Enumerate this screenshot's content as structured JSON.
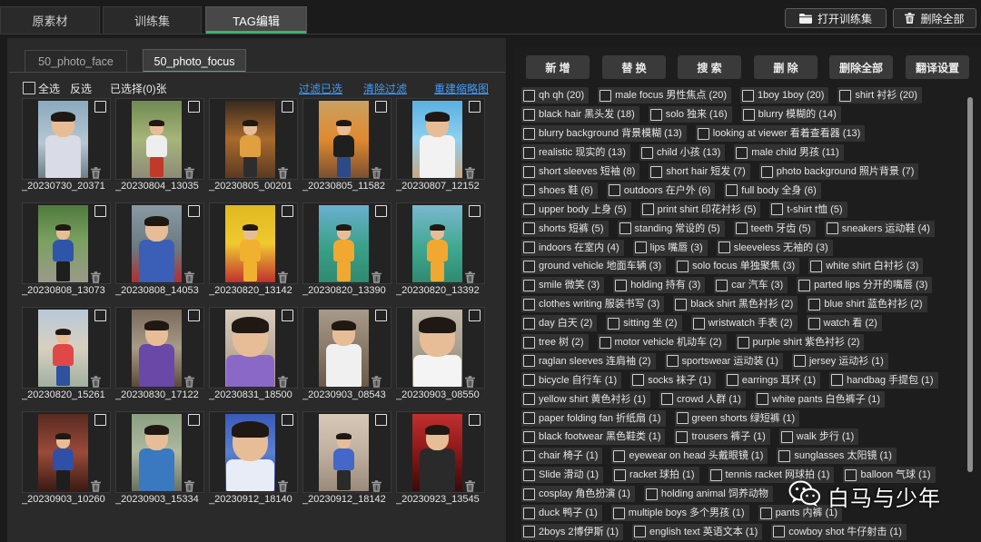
{
  "colors": {
    "accent": "#3bb46c",
    "link": "#3d9bff",
    "background": "#1b1b1b",
    "panel": "#2a2a2a",
    "tag_panel": "#1d1d1d"
  },
  "window": {
    "tabs": [
      "原素材",
      "训练集",
      "TAG编辑"
    ],
    "active_tab_index": 2,
    "open_dataset_label": "打开训练集",
    "open_dataset_icon": "folder-icon",
    "delete_all_label": "删除全部",
    "delete_all_icon": "trash-icon"
  },
  "dataset_tabs": {
    "items": [
      "50_photo_face",
      "50_photo_focus"
    ],
    "active_index": 1
  },
  "toolbar": {
    "select_all": "全选",
    "invert_selection": "反选",
    "selected_count": "已选择(0)张",
    "filter_selected": "过滤已选",
    "clear_filter": "清除过滤",
    "rebuild_thumbnails": "重建缩略图"
  },
  "gallery": {
    "item_icons": [
      "checkbox",
      "trash-icon"
    ],
    "items": [
      "_20230730_20371",
      "_20230804_13035",
      "_20230805_00201",
      "_20230805_11582",
      "_20230807_12152",
      "_20230808_13073",
      "_20230808_14053",
      "_20230820_13142",
      "_20230820_13390",
      "_20230820_13392",
      "_20230820_15261",
      "_20230830_17122",
      "_20230831_18500",
      "_20230903_08543",
      "_20230903_08550",
      "_20230903_10260",
      "_20230903_15334",
      "_20230912_18140",
      "_20230912_18142",
      "_20230923_13545"
    ]
  },
  "tag_actions": [
    "新 增",
    "替 换",
    "搜 索",
    "删 除",
    "删除全部",
    "翻译设置"
  ],
  "tags": {
    "rows": [
      [
        "qh qh (20)",
        "male focus 男性焦点 (20)",
        "1boy 1boy (20)",
        "shirt 衬衫 (20)"
      ],
      [
        "black hair 黑头发 (18)",
        "solo 独来 (16)",
        "blurry 模糊的 (14)"
      ],
      [
        "blurry background 背景模糊 (13)",
        "looking at viewer 看着查看器 (13)"
      ],
      [
        "realistic 现实的 (13)",
        "child 小孩 (13)",
        "male child 男孩 (11)"
      ],
      [
        "short sleeves 短袖 (8)",
        "short hair 短发 (7)",
        "photo background 照片背景 (7)"
      ],
      [
        "shoes 鞋 (6)",
        "outdoors 在户外 (6)",
        "full body 全身 (6)"
      ],
      [
        "upper body 上身 (5)",
        "print shirt 印花衬衫 (5)",
        "t-shirt t恤 (5)"
      ],
      [
        "shorts 短裤 (5)",
        "standing 常设的 (5)",
        "teeth 牙齿 (5)",
        "sneakers 运动鞋 (4)"
      ],
      [
        "indoors 在室内 (4)",
        "lips 嘴唇 (3)",
        "sleeveless 无袖的 (3)"
      ],
      [
        "ground vehicle 地面车辆 (3)",
        "solo focus 单独聚焦 (3)",
        "white shirt 白衬衫 (3)"
      ],
      [
        "smile 微笑 (3)",
        "holding 持有 (3)",
        "car 汽车 (3)",
        "parted lips 分开的嘴唇 (3)"
      ],
      [
        "clothes writing 服装书写 (3)",
        "black shirt 黑色衬衫 (2)",
        "blue shirt 蓝色衬衫 (2)"
      ],
      [
        "day 白天 (2)",
        "sitting 坐 (2)",
        "wristwatch 手表 (2)",
        "watch 看 (2)"
      ],
      [
        "tree 树 (2)",
        "motor vehicle 机动车 (2)",
        "purple shirt 紫色衬衫 (2)"
      ],
      [
        "raglan sleeves 连肩袖 (2)",
        "sportswear 运动装 (1)",
        "jersey 运动衫 (1)"
      ],
      [
        "bicycle 自行车 (1)",
        "socks 袜子 (1)",
        "earrings 耳环 (1)",
        "handbag 手提包 (1)"
      ],
      [
        "yellow shirt 黄色衬衫 (1)",
        "crowd 人群 (1)",
        "white pants 白色裤子 (1)"
      ],
      [
        "paper folding fan 折纸扇 (1)",
        "green shorts 绿短裤 (1)"
      ],
      [
        "black footwear 黑色鞋类 (1)",
        "trousers 裤子 (1)",
        "walk 步行 (1)"
      ],
      [
        "chair 椅子 (1)",
        "eyewear on head 头戴眼镜 (1)",
        "sunglasses 太阳镜 (1)"
      ],
      [
        "Slide 滑动 (1)",
        "racket 球拍 (1)",
        "tennis racket 网球拍 (1)",
        "balloon 气球 (1)"
      ],
      [
        "cosplay 角色扮演 (1)",
        "holding animal 饲养动物"
      ],
      [
        "duck 鸭子 (1)",
        "multiple boys 多个男孩 (1)",
        "pants 内裤 (1)"
      ],
      [
        "2boys 2博伊斯 (1)",
        "english text 英语文本 (1)",
        "cowboy shot 牛仔射击 (1)"
      ]
    ]
  },
  "watermark": {
    "icon": "wechat-icon",
    "text": "白马与少年"
  }
}
